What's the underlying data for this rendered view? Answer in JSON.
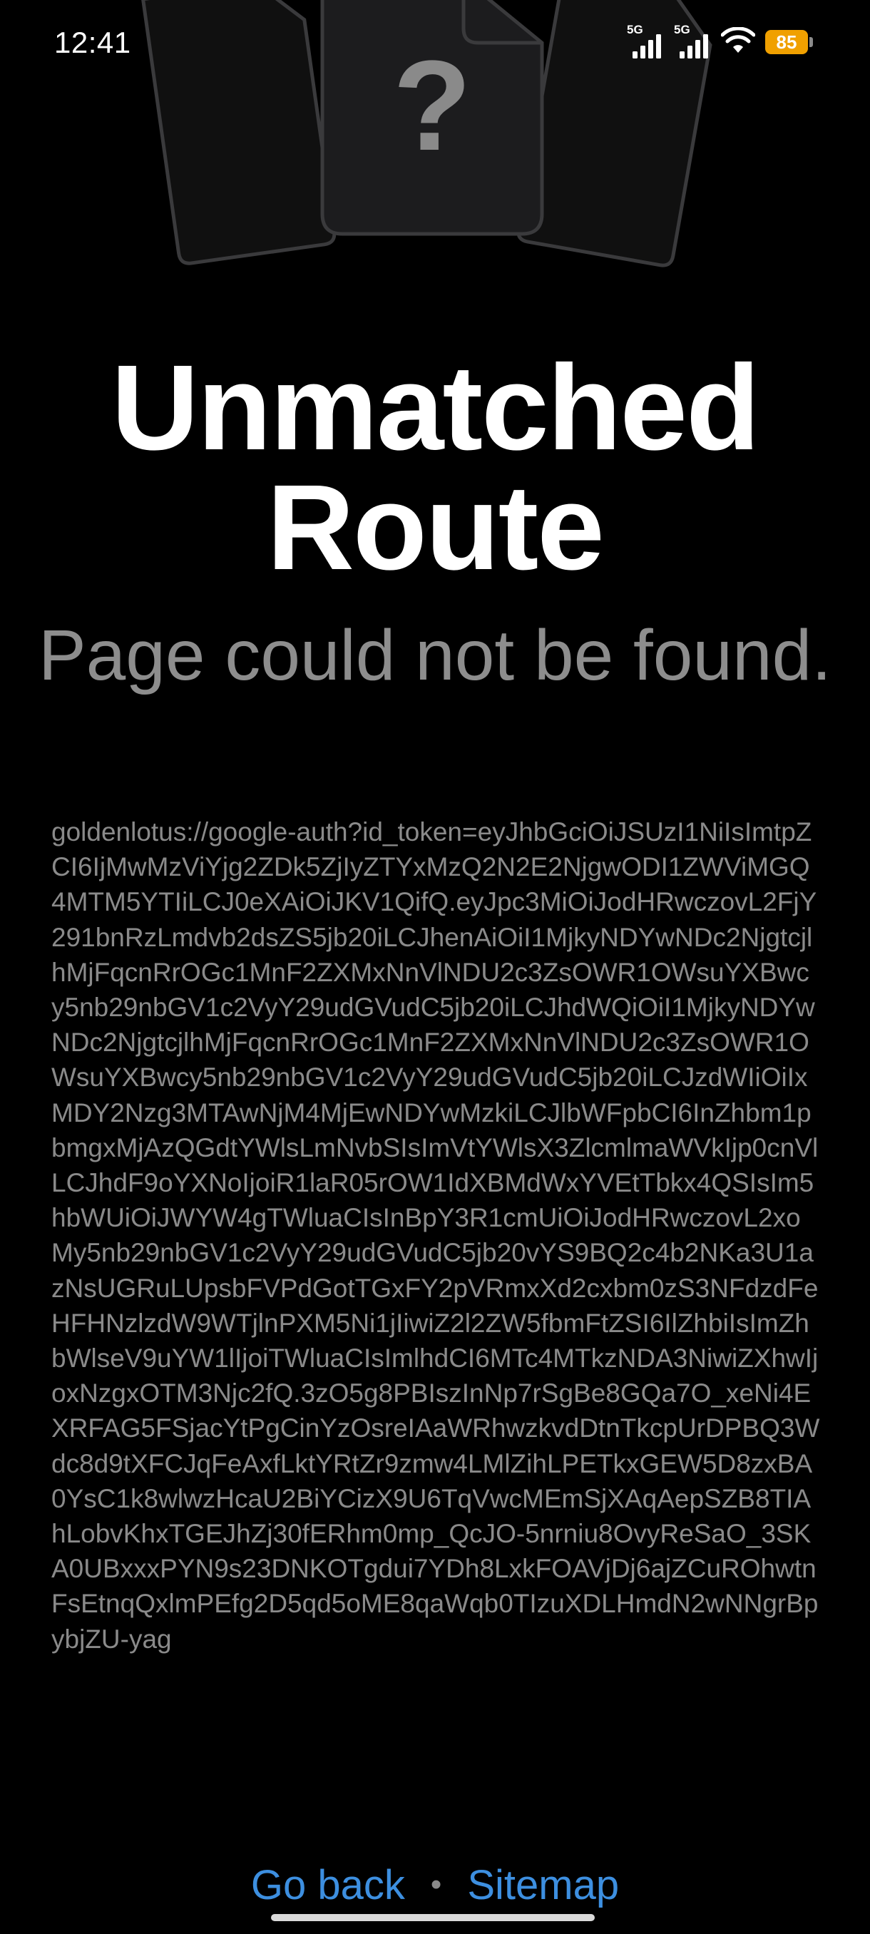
{
  "status_bar": {
    "time": "12:41",
    "network_1": "5G",
    "network_2": "5G",
    "battery": "85",
    "icons": [
      "signal-icon",
      "signal-icon",
      "wifi-icon",
      "battery-icon"
    ]
  },
  "illustration": {
    "symbol": "?",
    "icon": "missing-documents-icon"
  },
  "error": {
    "title": "Unmatched Route",
    "subtitle": "Page could not be found.",
    "url": "goldenlotus://google-auth?id_token=eyJhbGciOiJSUzI1NiIsImtpZCI6IjMwMzViYjg2ZDk5ZjIyZTYxMzQ2N2E2NjgwODI1ZWViMGQ4MTM5YTIiLCJ0eXAiOiJKV1QifQ.eyJpc3MiOiJodHRwczovL2FjY291bnRzLmdvb2dsZS5jb20iLCJhenAiOiI1MjkyNDYwNDc2NjgtcjlhMjFqcnRrOGc1MnF2ZXMxNnVlNDU2c3ZsOWR1OWsuYXBwcy5nb29nbGV1c2VyY29udGVudC5jb20iLCJhdWQiOiI1MjkyNDYwNDc2NjgtcjlhMjFqcnRrOGc1MnF2ZXMxNnVlNDU2c3ZsOWR1OWsuYXBwcy5nb29nbGV1c2VyY29udGVudC5jb20iLCJzdWIiOiIxMDY2Nzg3MTAwNjM4MjEwNDYwMzkiLCJlbWFpbCI6InZhbm1pbmgxMjAzQGdtYWlsLmNvbSIsImVtYWlsX3ZlcmlmaWVkIjp0cnVlLCJhdF9oYXNoIjoiR1laR05rOW1IdXBMdWxYVEtTbkx4QSIsIm5hbWUiOiJWYW4gTWluaCIsInBpY3R1cmUiOiJodHRwczovL2xoMy5nb29nbGV1c2VyY29udGVudC5jb20vYS9BQ2c4b2NKa3U1azNsUGRuLUpsbFVPdGotTGxFY2pVRmxXd2cxbm0zS3NFdzdFeHFHNzlzdW9WTjlnPXM5Ni1jIiwiZ2l2ZW5fbmFtZSI6IlZhbiIsImZhbWlseV9uYW1lIjoiTWluaCIsImlhdCI6MTc4MTkzNDA3NiwiZXhwIjoxNzgxOTM3Njc2fQ.3zO5g8PBIszInNp7rSgBe8GQa7O_xeNi4EXRFAG5FSjacYtPgCinYzOsreIAaWRhwzkvdDtnTkcpUrDPBQ3Wdc8d9tXFCJqFeAxfLktYRtZr9zmw4LMlZihLPETkxGEW5D8zxBA0YsC1k8wlwzHcaU2BiYCizX9U6TqVwcMEmSjXAqAepSZB8TIAhLobvKhxTGEJhZj30fERhm0mp_QcJO-5nrniu8OvyReSaO_3SKA0UBxxxPYN9s23DNKOTgdui7YDh8LxkFOAVjDj6ajZCuROhwtnFsEtnqQxlmPEfg2D5qd5oME8qaWqb0TIzuXDLHmdN2wNNgrBpybjZU-yag"
  },
  "footer": {
    "go_back_label": "Go back",
    "separator": "•",
    "sitemap_label": "Sitemap"
  },
  "colors": {
    "background": "#000000",
    "title": "#ffffff",
    "subtitle": "#8d8d8d",
    "url_text": "#8a8a8a",
    "link": "#3d8fe0",
    "battery": "#f0a000",
    "illustration_fill": "#1c1c1e",
    "illustration_stroke": "#3a3a3c"
  }
}
